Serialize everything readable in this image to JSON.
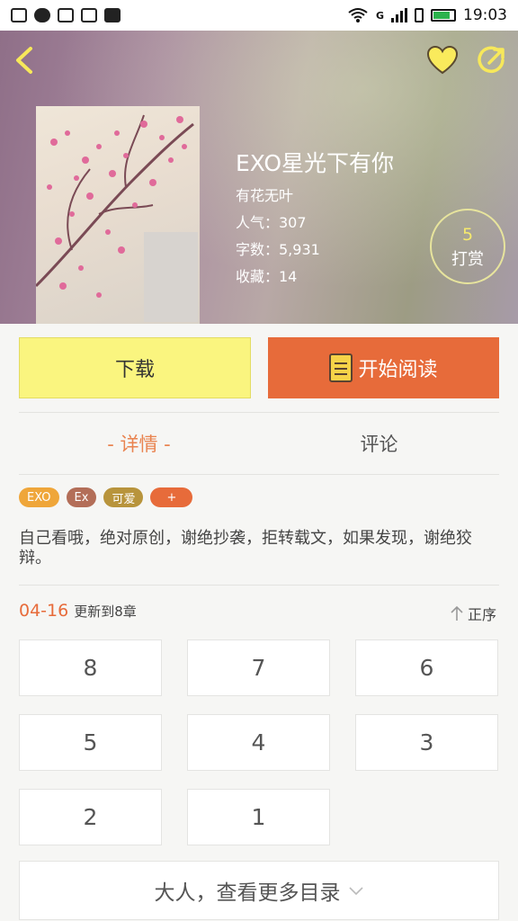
{
  "status_bar": {
    "time": "19:03",
    "network": "G"
  },
  "book": {
    "title": "EXO星光下有你",
    "author": "有花无叶",
    "popularity": "人气：307",
    "word_count": "字数：5,931",
    "favorites": "收藏：14"
  },
  "reward": {
    "count": "5",
    "label": "打赏"
  },
  "actions": {
    "download_label": "下载",
    "read_label": "开始阅读"
  },
  "tabs": [
    {
      "label": "- 详情 -",
      "active": true
    },
    {
      "label": "评论",
      "active": false
    }
  ],
  "tags": [
    {
      "label": "EXO",
      "color": "#efa63a"
    },
    {
      "label": "Ex",
      "color": "#b36e58"
    },
    {
      "label": "可爱",
      "color": "#b8943c"
    },
    {
      "label": "+",
      "color": "#e76b3a"
    }
  ],
  "description": "自己看哦，绝对原创，谢绝抄袭，拒转载文，如果发现，谢绝狡辩。",
  "update": {
    "date": "04-16",
    "text": "更新到8章"
  },
  "sort_label": "正序",
  "chapters": [
    "8",
    "7",
    "6",
    "5",
    "4",
    "3",
    "2",
    "1"
  ],
  "more_label": "大人，查看更多目录",
  "colors": {
    "accent": "#e76b3a",
    "download": "#faf57f",
    "reward_number": "#f6ea6d"
  }
}
